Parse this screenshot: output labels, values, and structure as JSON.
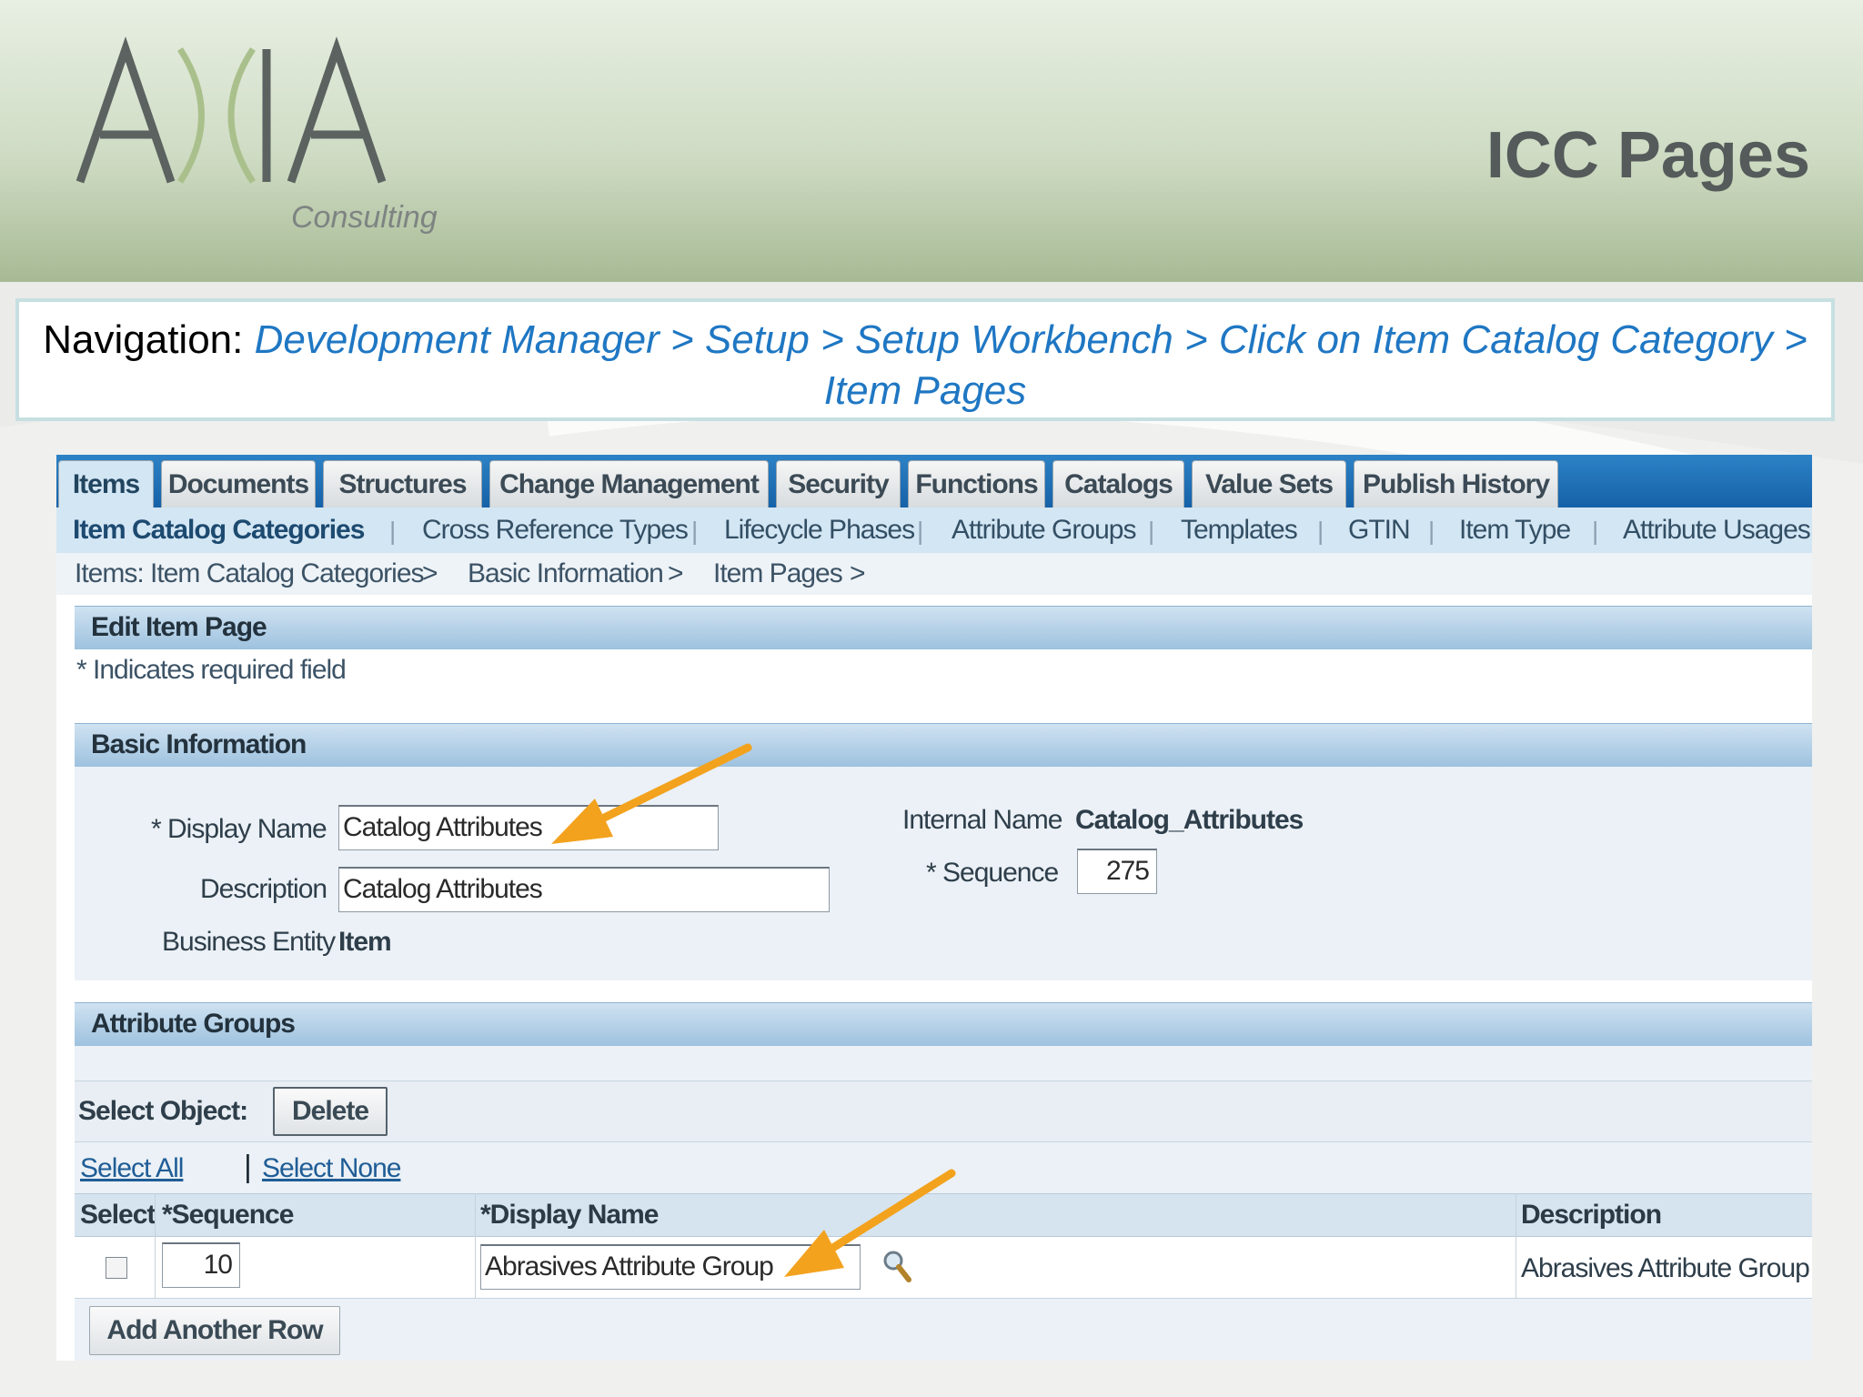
{
  "slide": {
    "title": "ICC Pages",
    "logo": {
      "wordmark": "AXIA",
      "tagline": "Consulting"
    }
  },
  "navigation": {
    "label": "Navigation:",
    "path": "Development Manager > Setup > Setup Workbench > Click on Item Catalog Category > Item Pages"
  },
  "app": {
    "tabs": [
      {
        "label": "Items",
        "active": true
      },
      {
        "label": "Documents"
      },
      {
        "label": "Structures"
      },
      {
        "label": "Change Management"
      },
      {
        "label": "Security"
      },
      {
        "label": "Functions"
      },
      {
        "label": "Catalogs"
      },
      {
        "label": "Value Sets"
      },
      {
        "label": "Publish History"
      }
    ],
    "subtabs": [
      {
        "label": "Item Catalog Categories",
        "active": true
      },
      {
        "label": "Cross Reference Types"
      },
      {
        "label": "Lifecycle Phases"
      },
      {
        "label": "Attribute Groups"
      },
      {
        "label": "Templates"
      },
      {
        "label": "GTIN"
      },
      {
        "label": "Item Type"
      },
      {
        "label": "Attribute Usages"
      }
    ],
    "breadcrumbs": [
      "Items: Item Catalog Categories",
      "Basic Information",
      "Item Pages"
    ],
    "breadcrumb_separator": ">",
    "page_title": "Edit Item Page",
    "required_note": "* Indicates required field",
    "basic_info": {
      "header": "Basic Information",
      "display_name_label": "* Display Name",
      "display_name_value": "Catalog Attributes",
      "description_label": "Description",
      "description_value": "Catalog Attributes",
      "business_entity_label": "Business Entity",
      "business_entity_value": "Item",
      "internal_name_label": "Internal Name",
      "internal_name_value": "Catalog_Attributes",
      "sequence_label": "* Sequence",
      "sequence_value": "275"
    },
    "attribute_groups": {
      "header": "Attribute Groups",
      "select_object_label": "Select Object:",
      "delete_button": "Delete",
      "select_all": "Select All",
      "select_none": "Select None",
      "columns": [
        "Select",
        "*Sequence",
        "*Display Name",
        "Description"
      ],
      "rows": [
        {
          "selected": false,
          "sequence": "10",
          "display_name": "Abrasives Attribute Group",
          "description": "Abrasives Attribute Group"
        }
      ],
      "add_row_button": "Add Another Row"
    }
  },
  "colors": {
    "nav_link": "#1f77c3",
    "tabbar": "#1561a8",
    "section_header": "#9ec2df",
    "arrow": "#f3a21e"
  },
  "icons": [
    "search-icon",
    "arrow-annotation",
    "arrow-annotation"
  ]
}
